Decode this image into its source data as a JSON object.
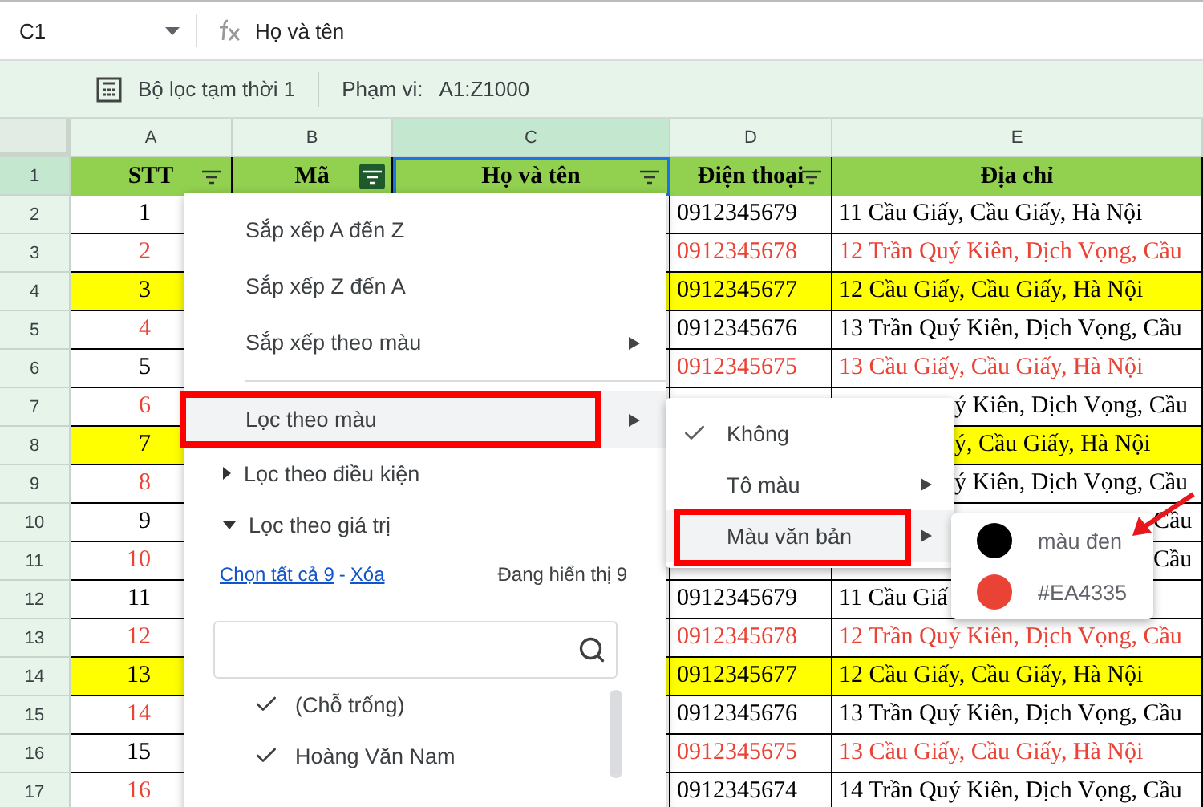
{
  "toolbar": {
    "cell_ref": "C1",
    "formula": "Họ và tên"
  },
  "filter_bar": {
    "filter_name": "Bộ lọc tạm thời 1",
    "range_label": "Phạm vi:",
    "range": "A1:Z1000"
  },
  "columns": [
    {
      "label": "A",
      "selected": false
    },
    {
      "label": "B",
      "selected": false
    },
    {
      "label": "C",
      "selected": true
    },
    {
      "label": "D",
      "selected": false
    },
    {
      "label": "E",
      "selected": false
    }
  ],
  "header_row": {
    "number": "1",
    "cells": [
      {
        "text": "STT",
        "filter_button": true,
        "filter_active": false,
        "selected": false
      },
      {
        "text": "Mã",
        "filter_button": true,
        "filter_active": true,
        "selected": false
      },
      {
        "text": "Họ và tên",
        "filter_button": true,
        "filter_active": false,
        "selected": true
      },
      {
        "text": "Điện thoại",
        "filter_button": true,
        "filter_active": false,
        "selected": false
      },
      {
        "text": "Địa chỉ",
        "filter_button": false,
        "selected": false
      }
    ]
  },
  "rows": [
    {
      "number": "2",
      "highlighted": false,
      "stt": {
        "text": "1",
        "color": "#000000"
      },
      "phone": {
        "text": "0912345679",
        "color": "#000000"
      },
      "address": {
        "text": "11 Cầu Giấy, Cầu Giấy, Hà Nội",
        "color": "#000000",
        "kind": "full"
      }
    },
    {
      "number": "3",
      "highlighted": false,
      "stt": {
        "text": "2",
        "color": "#ea4335"
      },
      "phone": {
        "text": "0912345678",
        "color": "#ea4335"
      },
      "address": {
        "text": "12 Trần Quý Kiên, Dịch Vọng, Cầu",
        "color": "#ea4335",
        "kind": "full"
      }
    },
    {
      "number": "4",
      "highlighted": true,
      "stt": {
        "text": "3",
        "color": "#000000"
      },
      "phone": {
        "text": "0912345677",
        "color": "#000000"
      },
      "address": {
        "text": "12 Cầu Giấy, Cầu Giấy, Hà Nội",
        "color": "#000000",
        "kind": "full"
      }
    },
    {
      "number": "5",
      "highlighted": false,
      "stt": {
        "text": "4",
        "color": "#ea4335"
      },
      "phone": {
        "text": "0912345676",
        "color": "#000000"
      },
      "address": {
        "text": "13 Trần Quý Kiên, Dịch Vọng, Cầu",
        "color": "#000000",
        "kind": "full"
      }
    },
    {
      "number": "6",
      "highlighted": false,
      "stt": {
        "text": "5",
        "color": "#000000"
      },
      "phone": {
        "text": "0912345675",
        "color": "#ea4335"
      },
      "address": {
        "text": "13 Cầu Giấy, Cầu Giấy, Hà Nội",
        "color": "#ea4335",
        "kind": "full"
      }
    },
    {
      "number": "7",
      "highlighted": false,
      "stt": {
        "text": "6",
        "color": "#ea4335"
      },
      "address": {
        "text": "ý Kiên, Dịch Vọng, Cầu",
        "color": "#000000",
        "kind": "after_menu"
      }
    },
    {
      "number": "8",
      "highlighted": true,
      "stt": {
        "text": "7",
        "color": "#000000"
      },
      "address": {
        "text": "ý, Cầu Giấy, Hà Nội",
        "color": "#000000",
        "kind": "after_menu"
      }
    },
    {
      "number": "9",
      "highlighted": false,
      "stt": {
        "text": "8",
        "color": "#ea4335"
      },
      "address": {
        "text": "ý Kiên, Dịch Vọng, Cầu",
        "color": "#000000",
        "kind": "after_menu"
      }
    },
    {
      "number": "10",
      "highlighted": false,
      "stt": {
        "text": "9",
        "color": "#000000"
      },
      "address": {
        "text": "Cầu",
        "color": "#000000",
        "kind": "after_popup"
      }
    },
    {
      "number": "11",
      "highlighted": false,
      "stt": {
        "text": "10",
        "color": "#ea4335"
      },
      "address": {
        "text": "Cầu",
        "color": "#000000",
        "kind": "after_popup"
      }
    },
    {
      "number": "12",
      "highlighted": false,
      "stt": {
        "text": "11",
        "color": "#000000"
      },
      "phone": {
        "text": "0912345679",
        "color": "#000000"
      },
      "address": {
        "text": "11 Cầu Giấ",
        "color": "#000000",
        "kind": "full"
      }
    },
    {
      "number": "13",
      "highlighted": false,
      "stt": {
        "text": "12",
        "color": "#ea4335"
      },
      "phone": {
        "text": "0912345678",
        "color": "#ea4335"
      },
      "address": {
        "text": "12 Trần Quý Kiên, Dịch Vọng, Cầu",
        "color": "#ea4335",
        "kind": "full"
      }
    },
    {
      "number": "14",
      "highlighted": true,
      "stt": {
        "text": "13",
        "color": "#000000"
      },
      "phone": {
        "text": "0912345677",
        "color": "#000000"
      },
      "address": {
        "text": "12 Cầu Giấy, Cầu Giấy, Hà Nội",
        "color": "#000000",
        "kind": "full"
      }
    },
    {
      "number": "15",
      "highlighted": false,
      "stt": {
        "text": "14",
        "color": "#ea4335"
      },
      "phone": {
        "text": "0912345676",
        "color": "#000000"
      },
      "address": {
        "text": "13 Trần Quý Kiên, Dịch Vọng, Cầu",
        "color": "#000000",
        "kind": "full"
      }
    },
    {
      "number": "16",
      "highlighted": false,
      "stt": {
        "text": "15",
        "color": "#000000"
      },
      "phone": {
        "text": "0912345675",
        "color": "#ea4335"
      },
      "address": {
        "text": "13 Cầu Giấy, Cầu Giấy, Hà Nội",
        "color": "#ea4335",
        "kind": "full"
      }
    },
    {
      "number": "17",
      "highlighted": false,
      "stt": {
        "text": "16",
        "color": "#ea4335"
      },
      "phone": {
        "text": "0912345674",
        "color": "#000000"
      },
      "address": {
        "text": "14 Trần Quý Kiên, Dịch Vọng, Cầu",
        "color": "#000000",
        "kind": "full"
      }
    }
  ],
  "filter_menu": {
    "items": [
      {
        "kind": "action",
        "label": "Sắp xếp A đến Z",
        "submenu": false,
        "selected": false
      },
      {
        "kind": "action",
        "label": "Sắp xếp Z đến A",
        "submenu": false,
        "selected": false
      },
      {
        "kind": "action",
        "label": "Sắp xếp theo màu",
        "submenu": true,
        "selected": false
      },
      {
        "kind": "divider"
      },
      {
        "kind": "action",
        "label": "Lọc theo màu",
        "submenu": true,
        "selected": true
      },
      {
        "kind": "section",
        "label": "Lọc theo điều kiện",
        "expanded": false
      },
      {
        "kind": "section",
        "label": "Lọc theo giá trị",
        "expanded": true
      }
    ],
    "select_all": "Chọn tất cả 9",
    "separator": "-",
    "clear": "Xóa",
    "shown_count": "Đang hiển thị 9",
    "values": [
      {
        "label": "(Chỗ trống)",
        "checked": true
      },
      {
        "label": "Hoàng Văn Nam",
        "checked": true
      }
    ]
  },
  "color_menu": {
    "items": [
      {
        "label": "Không",
        "checked": true,
        "submenu": false,
        "selected": false
      },
      {
        "label": "Tô màu",
        "checked": false,
        "submenu": true,
        "selected": false
      },
      {
        "label": "Màu văn bản",
        "checked": false,
        "submenu": true,
        "selected": true
      }
    ]
  },
  "text_colors": [
    {
      "label": "màu đen",
      "color": "#000000"
    },
    {
      "label": "#EA4335",
      "color": "#ea4335"
    }
  ]
}
